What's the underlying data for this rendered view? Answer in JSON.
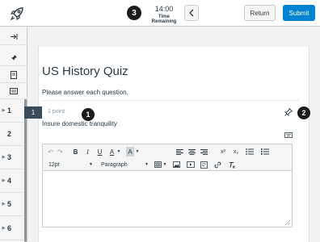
{
  "header": {
    "timer_value": "14:00",
    "timer_label": "Time Remaining",
    "return_label": "Return",
    "submit_label": "Submit"
  },
  "callouts": {
    "one": "1",
    "two": "2",
    "three": "3"
  },
  "sidebar": {
    "questions": [
      {
        "number": "1"
      },
      {
        "number": "2"
      },
      {
        "number": "3"
      },
      {
        "number": "4"
      },
      {
        "number": "5"
      },
      {
        "number": "6"
      }
    ]
  },
  "quiz": {
    "title": "US History Quiz",
    "instructions": "Please answer each question."
  },
  "question": {
    "number": "1",
    "points": "1 point",
    "text": "Insure domestic tranquility"
  },
  "editor": {
    "toolbar": {
      "bold": "B",
      "italic": "I",
      "underline": "U",
      "text_color": "A",
      "background_color": "A",
      "superscript": "x²",
      "subscript": "x₂",
      "font_size": "12pt",
      "format": "Paragraph"
    }
  },
  "colors": {
    "accent": "#0084d1",
    "question_badge": "#394b58",
    "callout": "#1b1b1b",
    "text": "#2d3b45"
  }
}
